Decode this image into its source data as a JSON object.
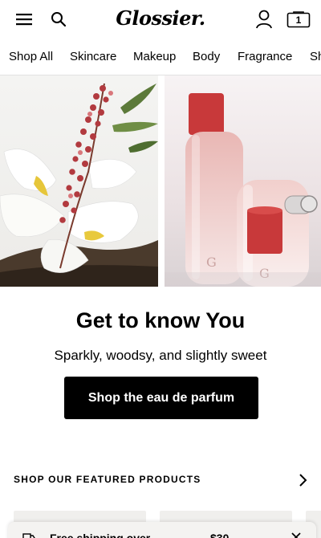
{
  "header": {
    "logo": "Glossier.",
    "cart_count": "1",
    "icons": {
      "menu": "hamburger-icon",
      "search": "search-icon",
      "account": "person-icon",
      "cart": "bag-icon"
    }
  },
  "nav": {
    "items": [
      {
        "label": "Shop All"
      },
      {
        "label": "Skincare"
      },
      {
        "label": "Makeup"
      },
      {
        "label": "Body"
      },
      {
        "label": "Fragrance"
      },
      {
        "label": "Sh"
      }
    ]
  },
  "hero": {
    "headline": "Get to know You",
    "subtitle": "Sparkly, woodsy, and slightly sweet",
    "cta_label": "Shop the eau de parfum"
  },
  "featured": {
    "label": "SHOP OUR FEATURED PRODUCTS"
  },
  "toast": {
    "text": "Free shipping over",
    "amount": "$30"
  },
  "colors": {
    "primary": "#000000",
    "background": "#ffffff",
    "perfume_cap": "#c8393a"
  }
}
